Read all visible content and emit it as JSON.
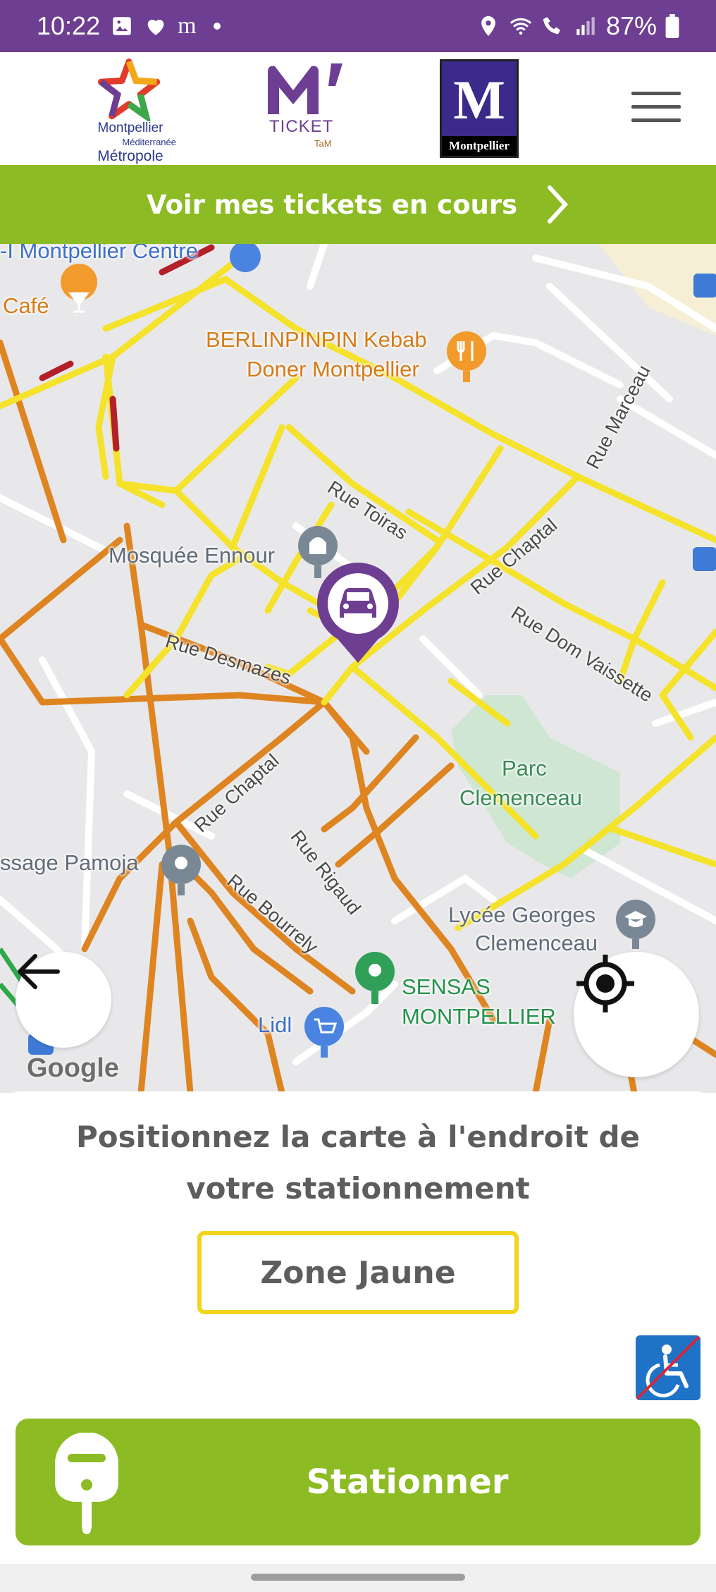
{
  "status_bar": {
    "time": "10:22",
    "battery": "87%",
    "app_glyph": "m",
    "icons": [
      "gallery-icon",
      "heart-icon",
      "location-icon",
      "wifi-call-icon",
      "signal-icon",
      "battery-icon"
    ]
  },
  "header": {
    "logo_metropole": {
      "line1": "Montpellier",
      "line2": "Méditerranée",
      "line3": "Métropole"
    },
    "logo_mticket": {
      "text": "TICKET",
      "sub": "TaM"
    },
    "logo_montpellier": {
      "letter": "M",
      "caption": "Montpellier"
    },
    "menu_icon": "hamburger-icon"
  },
  "banner": {
    "label": "Voir mes tickets en cours"
  },
  "map": {
    "labels": {
      "station": "-I Montpellier Centre",
      "cafe": "Café",
      "kebab_line1": "BERLINPINPIN Kebab",
      "kebab_line2": "Doner Montpellier",
      "mosque": "Mosquée Ennour",
      "rue_toiras": "Rue Toiras",
      "rue_chaptal_top": "Rue Chaptal",
      "rue_marceau": "Rue Marceau",
      "rue_dom_vaissette": "Rue Dom Vaissette",
      "rue_desmazes": "Rue Desmazes",
      "rue_chaptal_bottom": "Rue Chaptal",
      "parc_line1": "Parc",
      "parc_line2": "Clemenceau",
      "passage": "ssage Pamoja",
      "rue_rigaud": "Rue Rigaud",
      "rue_bourrely": "Rue Bourrely",
      "lycee_line1": "Lycée Georges",
      "lycee_line2": "Clemenceau",
      "sensas_line1": "SENSAS",
      "sensas_line2": "MONTPELLIER",
      "lidl": "Lidl",
      "google": "Google"
    },
    "colors": {
      "road_yellow": "#f5e22a",
      "road_orange": "#de8420",
      "road_red": "#b3202a",
      "park": "#cfe6d3"
    }
  },
  "panel": {
    "instruction": "Positionnez la carte à l'endroit de votre stationnement",
    "zone_label": "Zone Jaune",
    "park_label": "Stationner"
  },
  "colors": {
    "purple": "#6d3e91",
    "green": "#8dbb24",
    "zone_yellow": "#f3d41d",
    "handicap_blue": "#1f73c6"
  }
}
